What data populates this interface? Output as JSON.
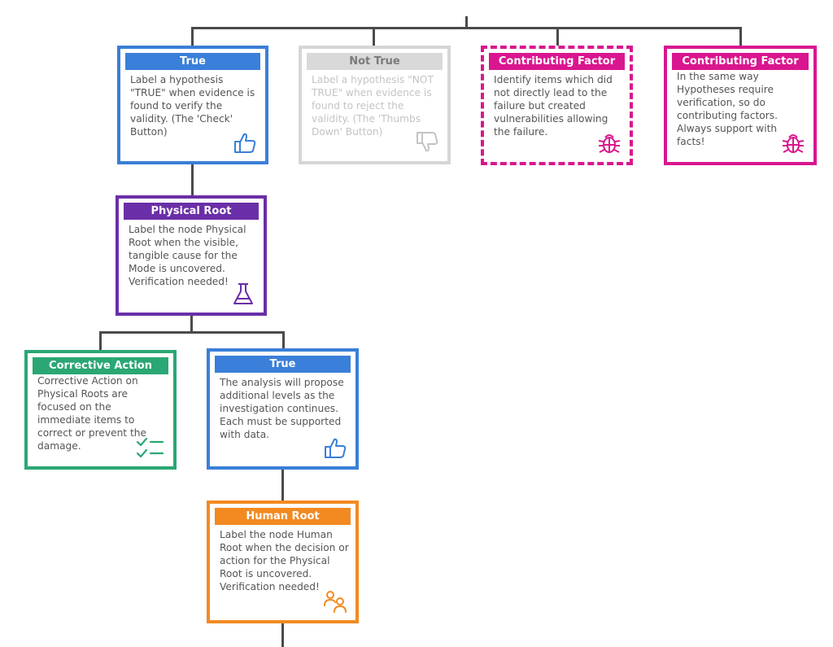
{
  "colors": {
    "true": "#3a7fd9",
    "not_true_border": "#d6d6d6",
    "not_true_header": "#d9d9d9",
    "not_true_header_text": "#7a7a7a",
    "not_true_text": "#c4c4c4",
    "contributing": "#d9168f",
    "physical_root": "#6a2fa8",
    "corrective": "#2aa774",
    "human_root": "#f28a21",
    "connector": "#4a4a4a",
    "body_text": "#555555"
  },
  "nodes": {
    "true_top": {
      "title": "True",
      "text": "Label a hypothesis \"TRUE\" when evidence is found to verify the validity. (The 'Check' Button)",
      "icon": "thumbs-up-icon"
    },
    "not_true": {
      "title": "Not True",
      "text": "Label a hypothesis \"NOT TRUE\" when evidence is found to reject the validity. (The 'Thumbs Down' Button)",
      "icon": "thumbs-down-icon"
    },
    "contributing_dashed": {
      "title": "Contributing Factor",
      "text": "Identify items which did not directly lead to the failure but created vulnerabilities allowing the failure.",
      "icon": "bug-icon"
    },
    "contributing_solid": {
      "title": "Contributing Factor",
      "text": "In the same way Hypotheses require verification, so do contributing factors. Always support with facts!",
      "icon": "bug-icon"
    },
    "physical_root": {
      "title": "Physical Root",
      "text": "Label the node Physical Root when the visible, tangible cause for the Mode is uncovered. Verification needed!",
      "icon": "flask-icon"
    },
    "corrective_action": {
      "title": "Corrective Action",
      "text": "Corrective Action on Physical Roots are focused on the immediate items to correct or prevent the damage.",
      "icon": "checklist-icon"
    },
    "true_lower": {
      "title": "True",
      "text": "The analysis will propose additional levels as the investigation continues. Each must be supported with data.",
      "icon": "thumbs-up-icon"
    },
    "human_root": {
      "title": "Human Root",
      "text": "Label the node Human Root when the decision or action for the Physical Root is uncovered. Verification needed!",
      "icon": "people-icon"
    }
  }
}
